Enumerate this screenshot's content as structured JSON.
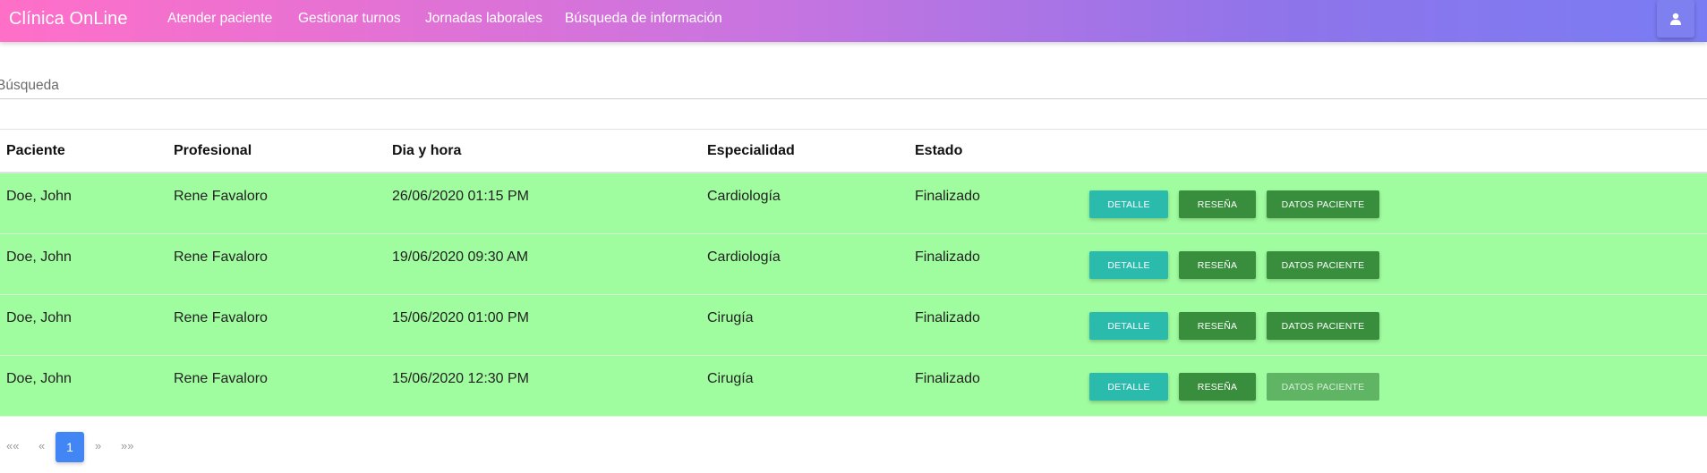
{
  "navbar": {
    "brand": "Clínica OnLine",
    "links": [
      "Atender paciente",
      "Gestionar turnos",
      "Jornadas laborales",
      "Búsqueda de información"
    ],
    "user_icon": "user-icon"
  },
  "search": {
    "label": "Búsqueda",
    "value": ""
  },
  "table": {
    "headers": [
      "Paciente",
      "Profesional",
      "Dia y hora",
      "Especialidad",
      "Estado"
    ],
    "rows": [
      {
        "paciente": "Doe, John",
        "profesional": "Rene Favaloro",
        "fecha": "26/06/2020 01:15 PM",
        "especialidad": "Cardiología",
        "estado": "Finalizado",
        "datos_enabled": true
      },
      {
        "paciente": "Doe, John",
        "profesional": "Rene Favaloro",
        "fecha": "19/06/2020 09:30 AM",
        "especialidad": "Cardiología",
        "estado": "Finalizado",
        "datos_enabled": true
      },
      {
        "paciente": "Doe, John",
        "profesional": "Rene Favaloro",
        "fecha": "15/06/2020 01:00 PM",
        "especialidad": "Cirugía",
        "estado": "Finalizado",
        "datos_enabled": true
      },
      {
        "paciente": "Doe, John",
        "profesional": "Rene Favaloro",
        "fecha": "15/06/2020 12:30 PM",
        "especialidad": "Cirugía",
        "estado": "Finalizado",
        "datos_enabled": false
      }
    ],
    "buttons": {
      "detalle": "Detalle",
      "resena": "Reseña",
      "datos": "Datos paciente"
    },
    "row_color": "#a0fd9f"
  },
  "pagination": {
    "first": "««",
    "prev": "«",
    "current": "1",
    "next": "»",
    "last": "»»"
  },
  "colors": {
    "nav_gradient_start": "#ff6fc8",
    "nav_gradient_end": "#7a7cf4",
    "detalle_button": "#2bbbad",
    "green_button": "#388e3c",
    "page_active": "#4285f4"
  }
}
